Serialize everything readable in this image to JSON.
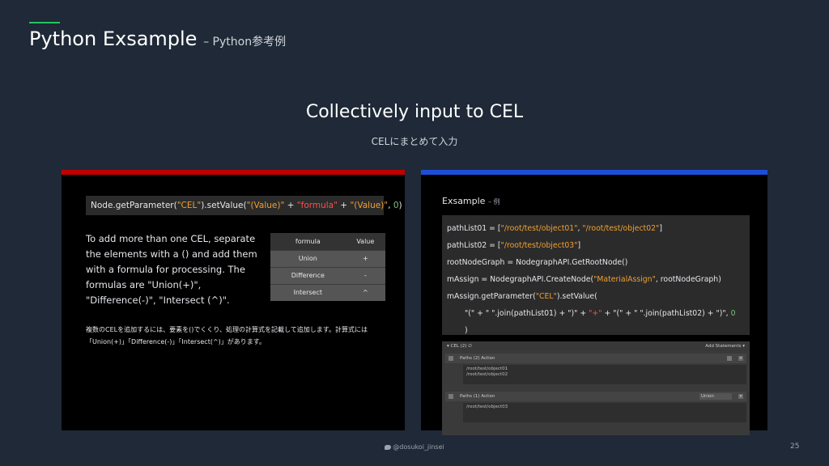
{
  "header": {
    "title": "Python Exsample",
    "subtitle": "– Python参考例"
  },
  "section": {
    "title": "Collectively input to CEL",
    "subtitle": "CELにまとめて入力"
  },
  "left_panel": {
    "code": {
      "part1": "Node.getParameter(",
      "part2": "\"CEL\"",
      "part3": ").setValue(",
      "part4": "\"(Value)\"",
      "part5": " + ",
      "part6": "\"formula\"",
      "part7": " + ",
      "part8": "\"(Value)\"",
      "part9": ", ",
      "part10": "0",
      "part11": ")"
    },
    "description": "To add more than one CEL, separate the elements with a () and add them with a formula for processing. The formulas are \"Union(+)\", \"Difference(-)\", \"Intersect (^)\".",
    "description_jp": "複数のCELを追加するには、要素を()でくくり、処理の計算式を記載して追加します。計算式には「Union(+)」「Difference(-)」「Intersect(^)」があります。",
    "table": {
      "headers": [
        "formula",
        "Value"
      ],
      "rows": [
        [
          "Union",
          "+"
        ],
        [
          "Difference",
          "-"
        ],
        [
          "Intersect",
          "^"
        ]
      ]
    }
  },
  "right_panel": {
    "title": "Exsample",
    "title_suffix": "– 例",
    "code_lines": {
      "l1a": "pathList01 = [",
      "l1b": "\"/root/test/object01\"",
      "l1c": ", ",
      "l1d": "\"/root/test/object02\"",
      "l1e": "]",
      "l2a": "pathList02 = [",
      "l2b": "\"/root/test/object03\"",
      "l2c": "]",
      "l3": "rootNodeGraph = NodegraphAPI.GetRootNode()",
      "l4a": "mAssign = NodegraphAPI.CreateNode(",
      "l4b": "\"MaterialAssign\"",
      "l4c": ", rootNodeGraph)",
      "l5a": "mAssign.getParameter(",
      "l5b": "\"CEL\"",
      "l5c": ").setValue(",
      "l6a": "\"(\" + \" \".join(pathList01) + \")\"",
      "l6b": " + ",
      "l6c": "\"+\"",
      "l6d": " + ",
      "l6e": "\"(\" + \" \".join(pathList02) + \")\"",
      "l6f": ", ",
      "l6g": "0",
      "l7": ")"
    },
    "cel_ui": {
      "header_label": "▾ CEL (2) ∅",
      "add_statements": "Add Statements ▾",
      "row1_label": "Paths (2)  Action",
      "row1_paths": [
        "/root/test/object01",
        "/root/test/object02"
      ],
      "row2_label": "Paths (1)  Action",
      "row2_select": "Union",
      "row2_paths": [
        "/root/test/object03"
      ]
    }
  },
  "footer": {
    "handle": "@dosukoi_jinsei",
    "page": "25"
  },
  "colors": {
    "accent_green": "#22c55e",
    "left_bar": "#c00000",
    "right_bar": "#1d4ed8",
    "string": "#f0a030"
  }
}
